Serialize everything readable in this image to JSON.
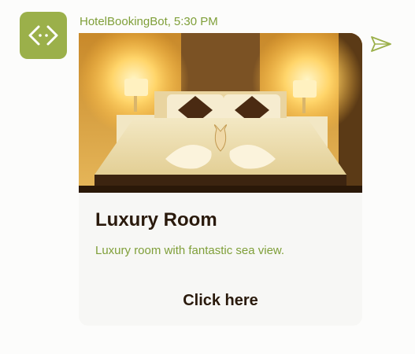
{
  "bot": {
    "avatar_icon": "code-brackets-icon",
    "name": "HotelBookingBot",
    "separator": ",",
    "time": "5:30 PM"
  },
  "card": {
    "image_icon": "hotel-room-photo",
    "title": "Luxury Room",
    "subtitle": "Luxury room with fantastic sea view.",
    "action_label": "Click here"
  },
  "send": {
    "icon": "send-icon"
  },
  "colors": {
    "accent": "#9bb04a",
    "accent_text": "#7f9f39",
    "title_text": "#2a1a0c",
    "card_bg": "#f7f7f5"
  }
}
